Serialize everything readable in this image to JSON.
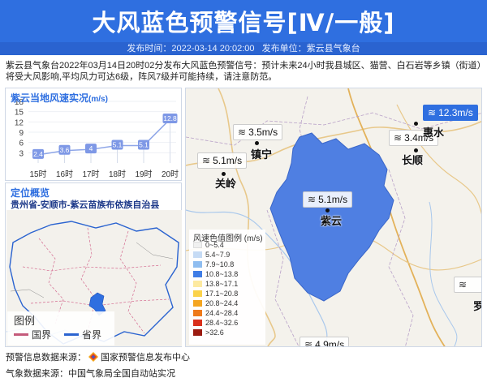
{
  "header": {
    "title": "大风蓝色预警信号[Ⅳ/一般]",
    "publish_time_label": "发布时间：2022-03-14 20:02:00",
    "publish_unit_label": "发布单位：紫云县气象台"
  },
  "description": "紫云县气象台2022年03月14日20时02分发布大风蓝色预警信号：预计未来24小时我县城区、猫营、白石岩等乡镇（街道）将受大风影响,平均风力可达6级，阵风7级并可能持续，请注意防范。",
  "chart_panel": {
    "title": "紫云当地风速实况",
    "unit": "(m/s)"
  },
  "chart_data": {
    "type": "line",
    "categories": [
      "15时",
      "16时",
      "17时",
      "18时",
      "19时",
      "20时"
    ],
    "values": [
      2.4,
      3.6,
      4,
      5.1,
      5.1,
      12.8
    ],
    "value_labels": [
      "2.4",
      "3.6",
      "4",
      "5.1",
      "5.1",
      "12.8"
    ],
    "y_ticks": [
      "18",
      "15",
      "12",
      "9",
      "6",
      "3"
    ],
    "ylim": [
      0,
      18
    ],
    "color": "#8ea6e8",
    "highlight_color": "#7e98e6"
  },
  "location_panel": {
    "title": "定位概览",
    "subtitle": "贵州省-安顺市-紫云苗族布依族自治县",
    "legend": {
      "title": "图例",
      "items": [
        {
          "label": "国界",
          "color": "#c45a7a"
        },
        {
          "label": "省界",
          "color": "#2a63d0"
        }
      ]
    }
  },
  "main_map": {
    "wind_labels": [
      {
        "value": "12.3m/s",
        "highlight": true
      },
      {
        "value": "3.5m/s",
        "highlight": false
      },
      {
        "value": "3.4m/s",
        "highlight": false
      },
      {
        "value": "5.1m/s",
        "highlight": false
      },
      {
        "value": "5.1m/s",
        "highlight": false
      },
      {
        "value": "4.9m/s",
        "highlight": false
      }
    ],
    "cities": [
      {
        "name": "惠水"
      },
      {
        "name": "镇宁"
      },
      {
        "name": "长顺"
      },
      {
        "name": "关岭"
      },
      {
        "name": "紫云"
      },
      {
        "name": "罗"
      }
    ],
    "scale": {
      "title": "风速色值图例 (m/s)",
      "items": [
        {
          "label": "0~5.4",
          "color": "#f0f0f0"
        },
        {
          "label": "5.4~7.9",
          "color": "#c6dbf5"
        },
        {
          "label": "7.9~10.8",
          "color": "#8fbdf0"
        },
        {
          "label": "10.8~13.8",
          "color": "#3f7de6"
        },
        {
          "label": "13.8~17.1",
          "color": "#fde9a0"
        },
        {
          "label": "17.1~20.8",
          "color": "#fbd24a"
        },
        {
          "label": "20.8~24.4",
          "color": "#f4a520"
        },
        {
          "label": "24.4~28.4",
          "color": "#ee7a1a"
        },
        {
          "label": "28.4~32.6",
          "color": "#d9301c"
        },
        {
          "label": ">32.6",
          "color": "#9b1a10"
        }
      ]
    }
  },
  "footer": {
    "warning_source": "预警信息数据来源：",
    "warning_source_name": "国家预警信息发布中心",
    "weather_source": "气象数据来源：中国气象局全国自动站实况"
  }
}
